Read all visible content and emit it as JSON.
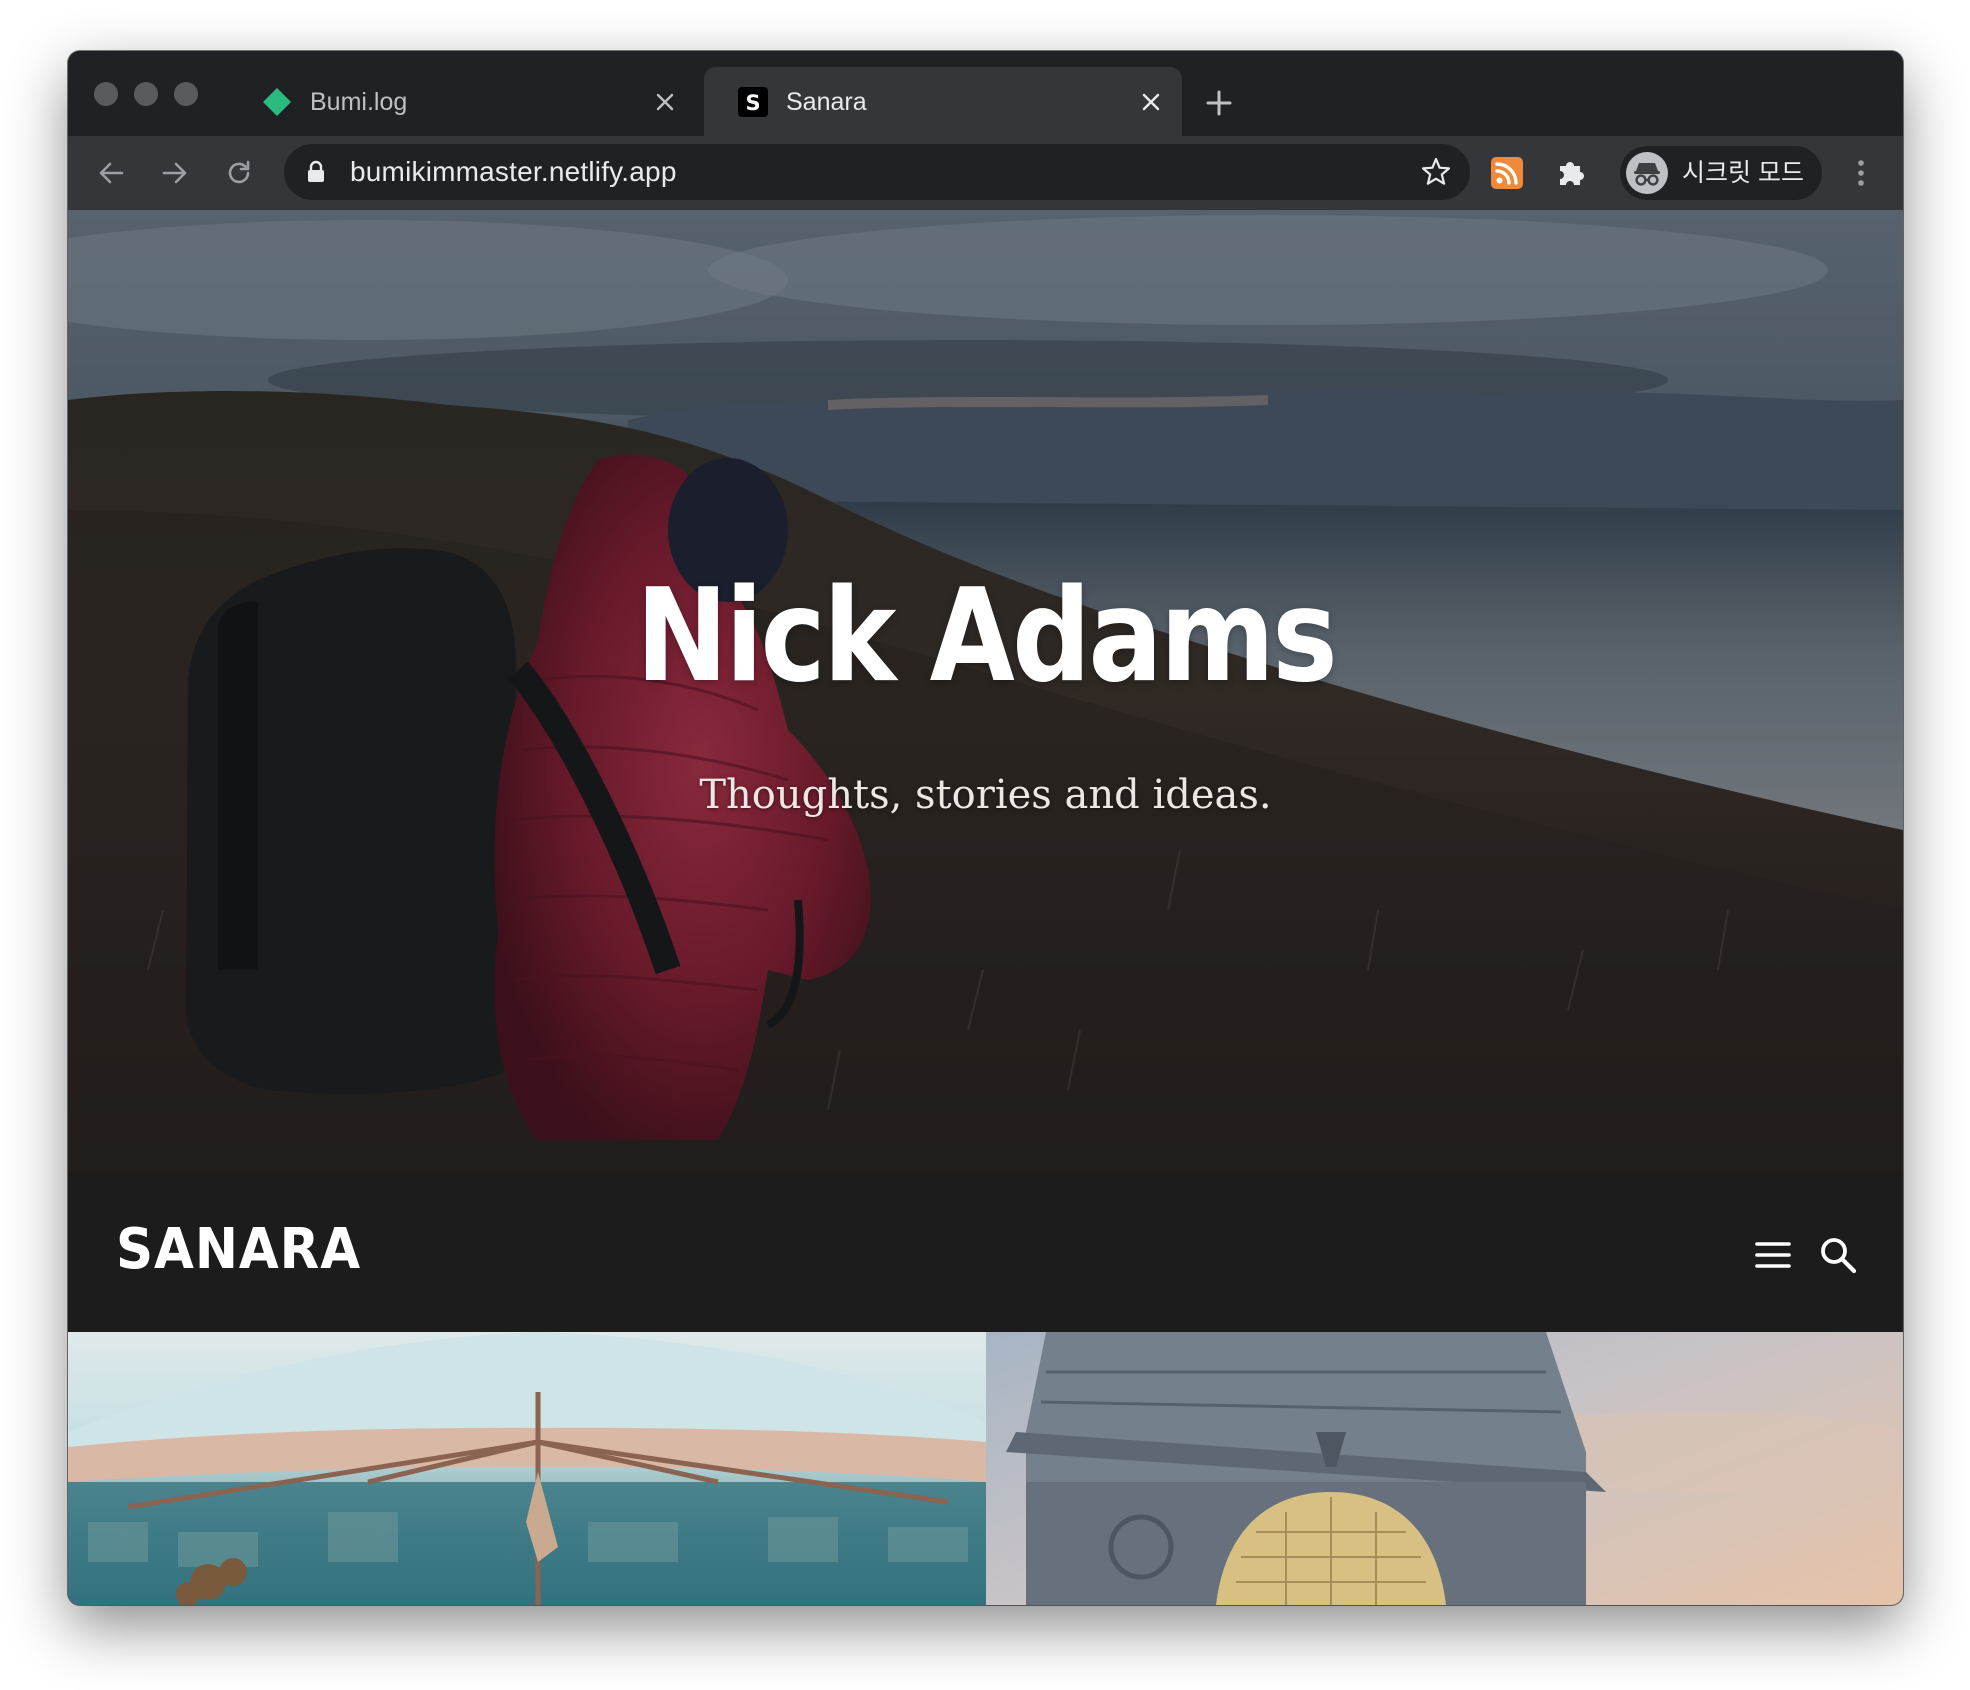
{
  "browser": {
    "tabs": [
      {
        "title": "Bumi.log",
        "active": false,
        "favicon": "green-diamond-icon",
        "favicon_color": "#2bbb7e"
      },
      {
        "title": "Sanara",
        "active": true,
        "favicon": "s-letter-icon"
      }
    ],
    "url": "bumikimmaster.netlify.app",
    "incognito_label": "시크릿 모드",
    "colors": {
      "frame": "#202124",
      "toolbar": "#35363a",
      "rss": "#f0893a"
    }
  },
  "page": {
    "hero": {
      "title": "Nick Adams",
      "subtitle": "Thoughts, stories and ideas."
    },
    "header": {
      "logo": "SANARA"
    },
    "colors": {
      "header_bg": "#1c1c1d"
    }
  }
}
